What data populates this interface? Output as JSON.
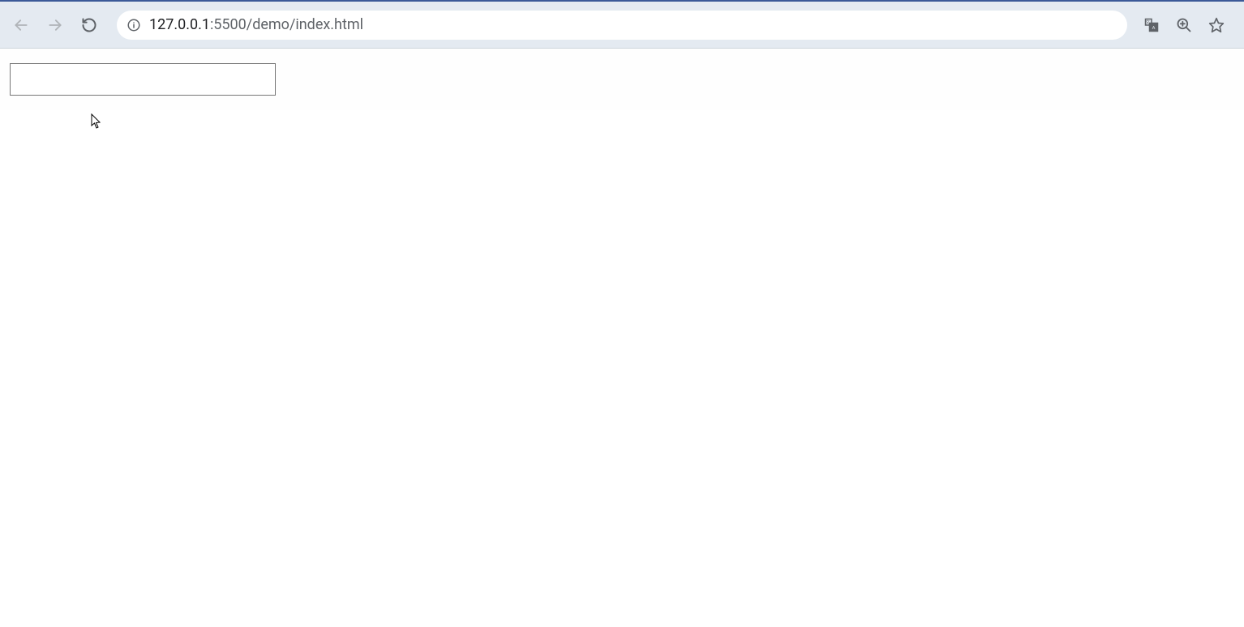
{
  "browser": {
    "url_host": "127.0.0.1",
    "url_port": ":5500",
    "url_path": "/demo/index.html"
  },
  "page": {
    "input_value": ""
  }
}
